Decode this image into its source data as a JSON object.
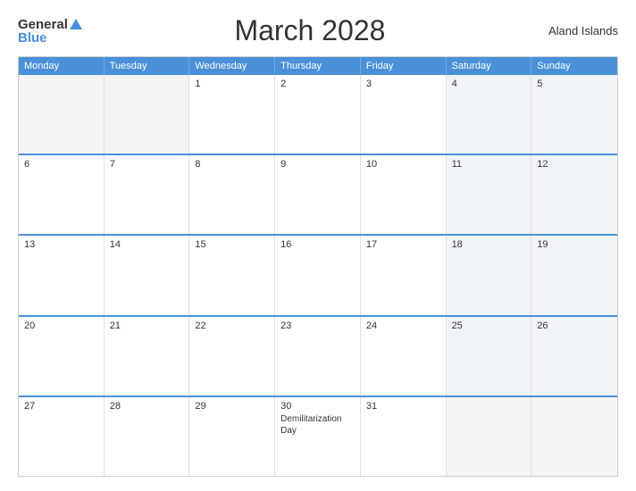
{
  "header": {
    "logo_general": "General",
    "logo_blue": "Blue",
    "title": "March 2028",
    "region": "Aland Islands"
  },
  "days": [
    "Monday",
    "Tuesday",
    "Wednesday",
    "Thursday",
    "Friday",
    "Saturday",
    "Sunday"
  ],
  "weeks": [
    [
      {
        "num": "",
        "event": "",
        "empty": true
      },
      {
        "num": "",
        "event": "",
        "empty": true
      },
      {
        "num": "1",
        "event": ""
      },
      {
        "num": "2",
        "event": ""
      },
      {
        "num": "3",
        "event": ""
      },
      {
        "num": "4",
        "event": ""
      },
      {
        "num": "5",
        "event": ""
      }
    ],
    [
      {
        "num": "6",
        "event": ""
      },
      {
        "num": "7",
        "event": ""
      },
      {
        "num": "8",
        "event": ""
      },
      {
        "num": "9",
        "event": ""
      },
      {
        "num": "10",
        "event": ""
      },
      {
        "num": "11",
        "event": ""
      },
      {
        "num": "12",
        "event": ""
      }
    ],
    [
      {
        "num": "13",
        "event": ""
      },
      {
        "num": "14",
        "event": ""
      },
      {
        "num": "15",
        "event": ""
      },
      {
        "num": "16",
        "event": ""
      },
      {
        "num": "17",
        "event": ""
      },
      {
        "num": "18",
        "event": ""
      },
      {
        "num": "19",
        "event": ""
      }
    ],
    [
      {
        "num": "20",
        "event": ""
      },
      {
        "num": "21",
        "event": ""
      },
      {
        "num": "22",
        "event": ""
      },
      {
        "num": "23",
        "event": ""
      },
      {
        "num": "24",
        "event": ""
      },
      {
        "num": "25",
        "event": ""
      },
      {
        "num": "26",
        "event": ""
      }
    ],
    [
      {
        "num": "27",
        "event": ""
      },
      {
        "num": "28",
        "event": ""
      },
      {
        "num": "29",
        "event": ""
      },
      {
        "num": "30",
        "event": "Demilitarization Day"
      },
      {
        "num": "31",
        "event": ""
      },
      {
        "num": "",
        "event": "",
        "empty": true
      },
      {
        "num": "",
        "event": "",
        "empty": true
      }
    ]
  ],
  "colors": {
    "header_bg": "#4a90d9",
    "border_blue": "#4a90d9",
    "shaded": "#f0f4f8"
  }
}
